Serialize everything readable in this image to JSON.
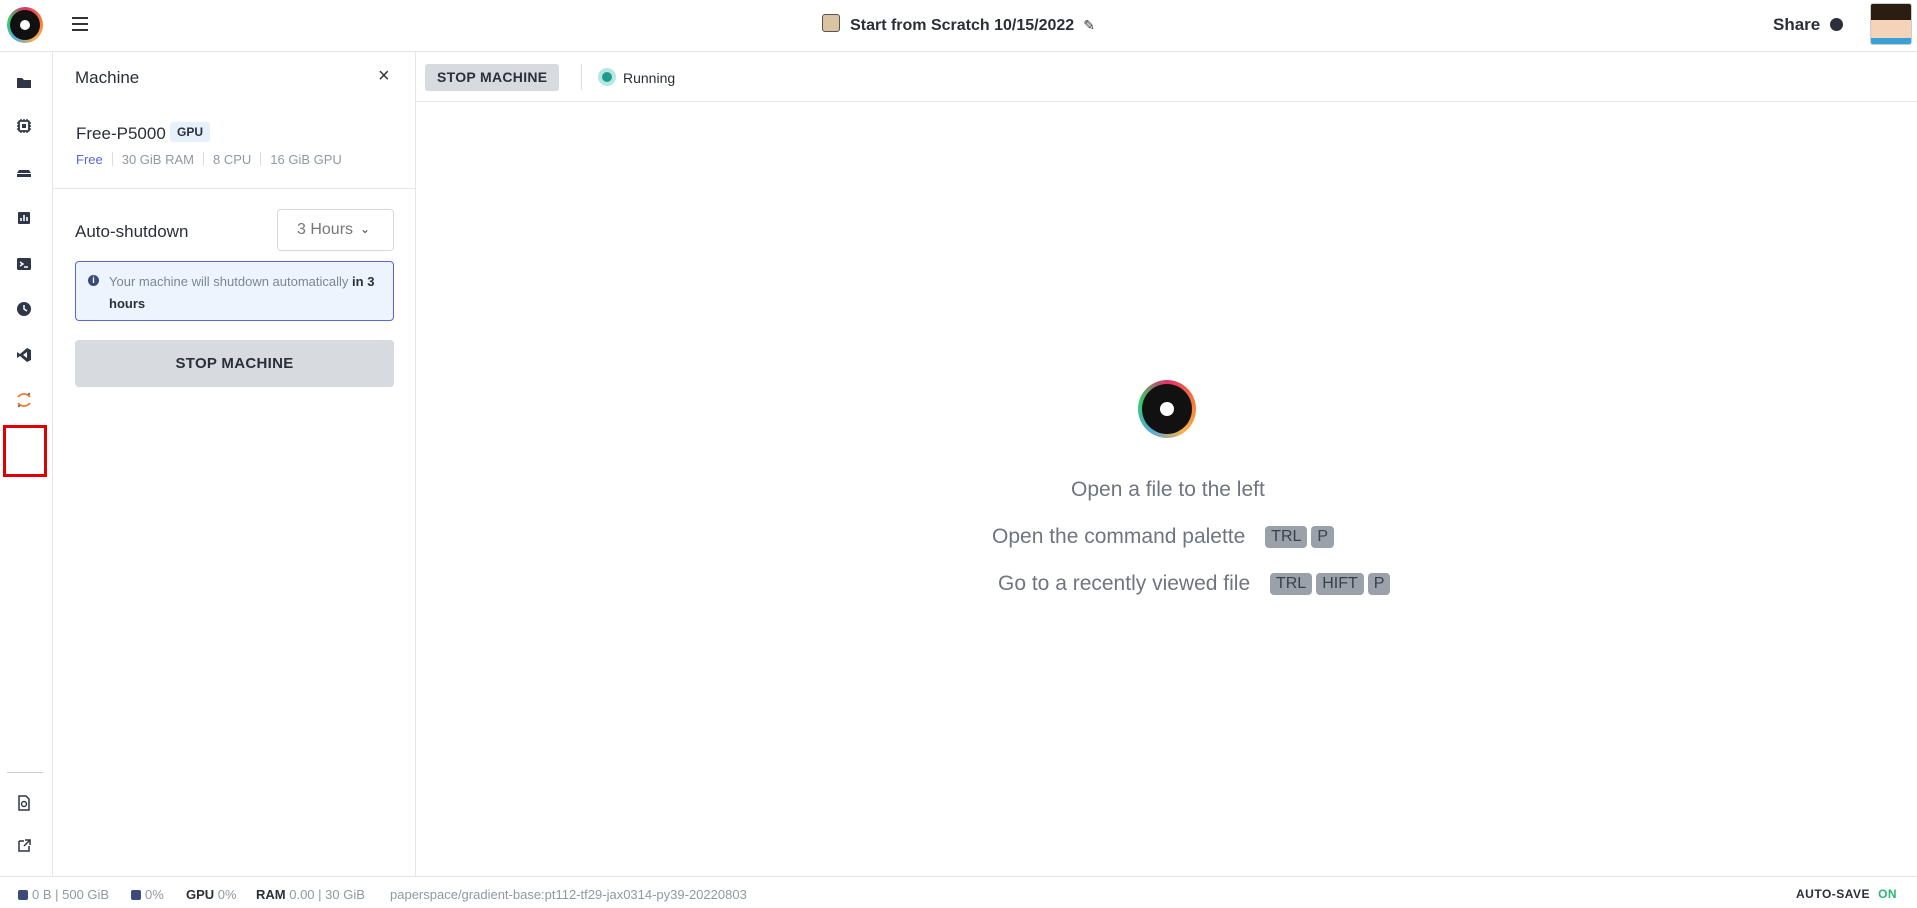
{
  "header": {
    "title": "Start from Scratch 10/15/2022",
    "share_label": "Share"
  },
  "rail": {
    "items": [
      "folder-icon",
      "cpu-icon",
      "layers-icon",
      "chart-icon",
      "terminal-icon",
      "clock-icon",
      "vscode-icon",
      "jupyter-icon"
    ],
    "bottom_items": [
      "docs-icon",
      "external-icon"
    ]
  },
  "panel": {
    "title": "Machine",
    "machine_name": "Free-P5000",
    "gpu_badge": "GPU",
    "specs": {
      "tier": "Free",
      "ram": "30 GiB RAM",
      "cpu": "8 CPU",
      "gpu": "16 GiB GPU"
    },
    "auto_shutdown_label": "Auto-shutdown",
    "auto_shutdown_value": "3 Hours",
    "info_text": "Your machine will shutdown automatically",
    "info_bold": "in 3 hours",
    "stop_button": "STOP MACHINE"
  },
  "toolbar": {
    "stop_button": "STOP MACHINE",
    "status": "Running",
    "status_color": "#1f9a8e"
  },
  "empty_state": {
    "line1": "Open a file to the left",
    "line2": "Open the command palette",
    "line2_keys": [
      "TRL",
      "P"
    ],
    "line3": "Go to a recently viewed file",
    "line3_keys": [
      "TRL",
      "HIFT",
      "P"
    ]
  },
  "statusbar": {
    "storage": "0 B | 500 GiB",
    "cpu": "0%",
    "gpu_label": "GPU",
    "gpu": "0%",
    "ram_label": "RAM",
    "ram": "0.00 | 30 GiB",
    "image": "paperspace/gradient-base:pt112-tf29-jax0314-py39-20220803",
    "autosave_label": "AUTO-SAVE",
    "autosave_value": "ON"
  }
}
